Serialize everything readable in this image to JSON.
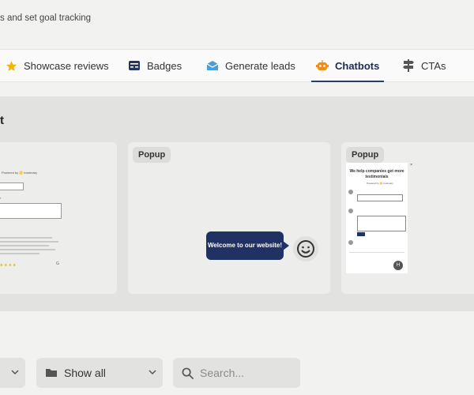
{
  "header": {
    "subtitle": "s and set goal tracking"
  },
  "tabs": [
    {
      "label": "Showcase reviews",
      "icon": "star-icon"
    },
    {
      "label": "Badges",
      "icon": "badge-icon"
    },
    {
      "label": "Generate leads",
      "icon": "envelope-icon"
    },
    {
      "label": "Chatbots",
      "icon": "robot-icon",
      "active": true
    },
    {
      "label": "CTAs",
      "icon": "signpost-icon"
    }
  ],
  "panel": {
    "title": "t",
    "cards": [
      {
        "powered_by": "Powered by 🟡 trustmary",
        "stars": "★★★★★",
        "g_mark": "G"
      },
      {
        "chip": "Popup",
        "bubble_text": "Welcome to our website!"
      },
      {
        "chip": "Popup",
        "heading": "We help companies get more testimonials",
        "powered_by": "Powered by 🟡 trustmary",
        "close": "×",
        "avatar": "H"
      }
    ]
  },
  "filters": {
    "show_all": "Show all",
    "search_placeholder": "Search..."
  },
  "colors": {
    "accent": "#1f3263",
    "star": "#f4b400",
    "envelope": "#4a9fd8",
    "robot": "#f08c1a"
  }
}
